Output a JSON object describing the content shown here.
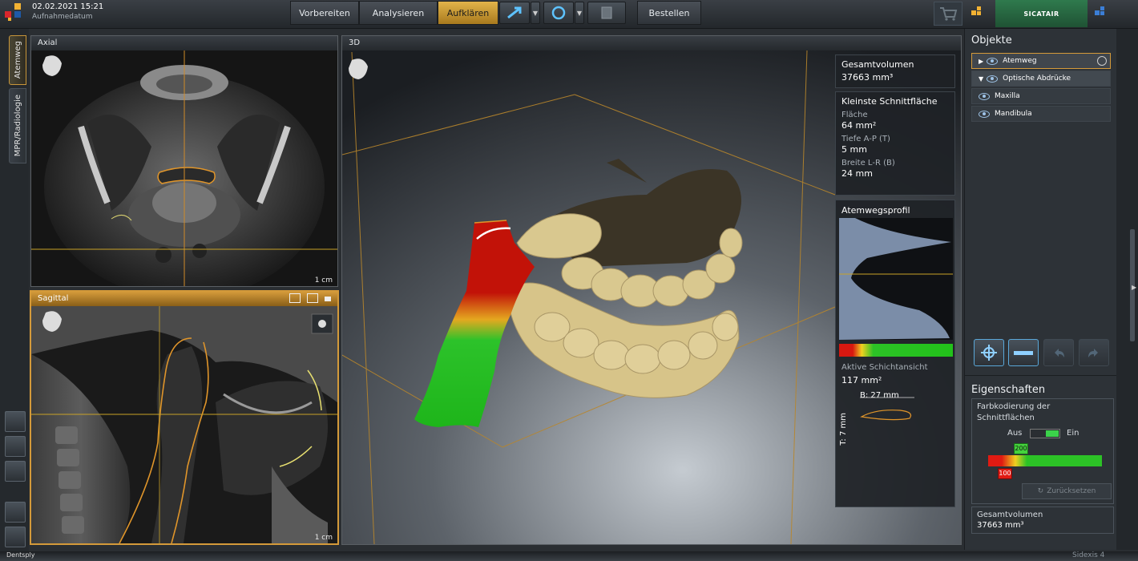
{
  "header": {
    "date": "02.02.2021 15:21",
    "date_label": "Aufnahmedatum",
    "steps": [
      "Vorbereiten",
      "Analysieren",
      "Aufklären",
      "Bestellen"
    ],
    "brand": "SICATAIR"
  },
  "left_tabs": [
    "Atemweg",
    "MPR/Radiologie"
  ],
  "views": {
    "axial": {
      "title": "Axial",
      "scale": "1 cm"
    },
    "sagittal": {
      "title": "Sagittal",
      "scale": "1 cm"
    },
    "three_d": {
      "title": "3D"
    }
  },
  "info": {
    "total_volume_label": "Gesamtvolumen",
    "total_volume_value": "37663 mm³",
    "min_section_title": "Kleinste Schnittfläche",
    "area_label": "Fläche",
    "area_value": "64 mm²",
    "depth_label": "Tiefe A-P (T)",
    "depth_value": "5 mm",
    "width_label": "Breite L-R (B)",
    "width_value": "24 mm",
    "profile_title": "Atemwegsprofil",
    "active_layer_label": "Aktive Schichtansicht",
    "active_layer_value": "117 mm²",
    "b_label": "B: 27 mm",
    "t_label": "T: 7 mm"
  },
  "objects": {
    "title": "Objekte",
    "items": [
      {
        "label": "Atemweg"
      },
      {
        "label": "Optische Abdrücke"
      },
      {
        "label": "Maxilla"
      },
      {
        "label": "Mandibula"
      }
    ]
  },
  "properties": {
    "title": "Eigenschaften",
    "color_coding_label": "Farbkodierung der Schnittflächen",
    "off_label": "Aus",
    "on_label": "Ein",
    "marker_high": "200",
    "marker_low": "100",
    "reset_label": "Zurücksetzen",
    "total_volume_label": "Gesamtvolumen",
    "total_volume_value": "37663 mm³"
  },
  "footer": {
    "company": "Dentsply",
    "product": "Sidexis 4"
  },
  "colors": {
    "accent": "#d49a3a",
    "airway_red": "#cc1a10",
    "airway_green": "#22c21a",
    "teeth": "#d9c88f",
    "selected_frame": "#d49a3a"
  }
}
